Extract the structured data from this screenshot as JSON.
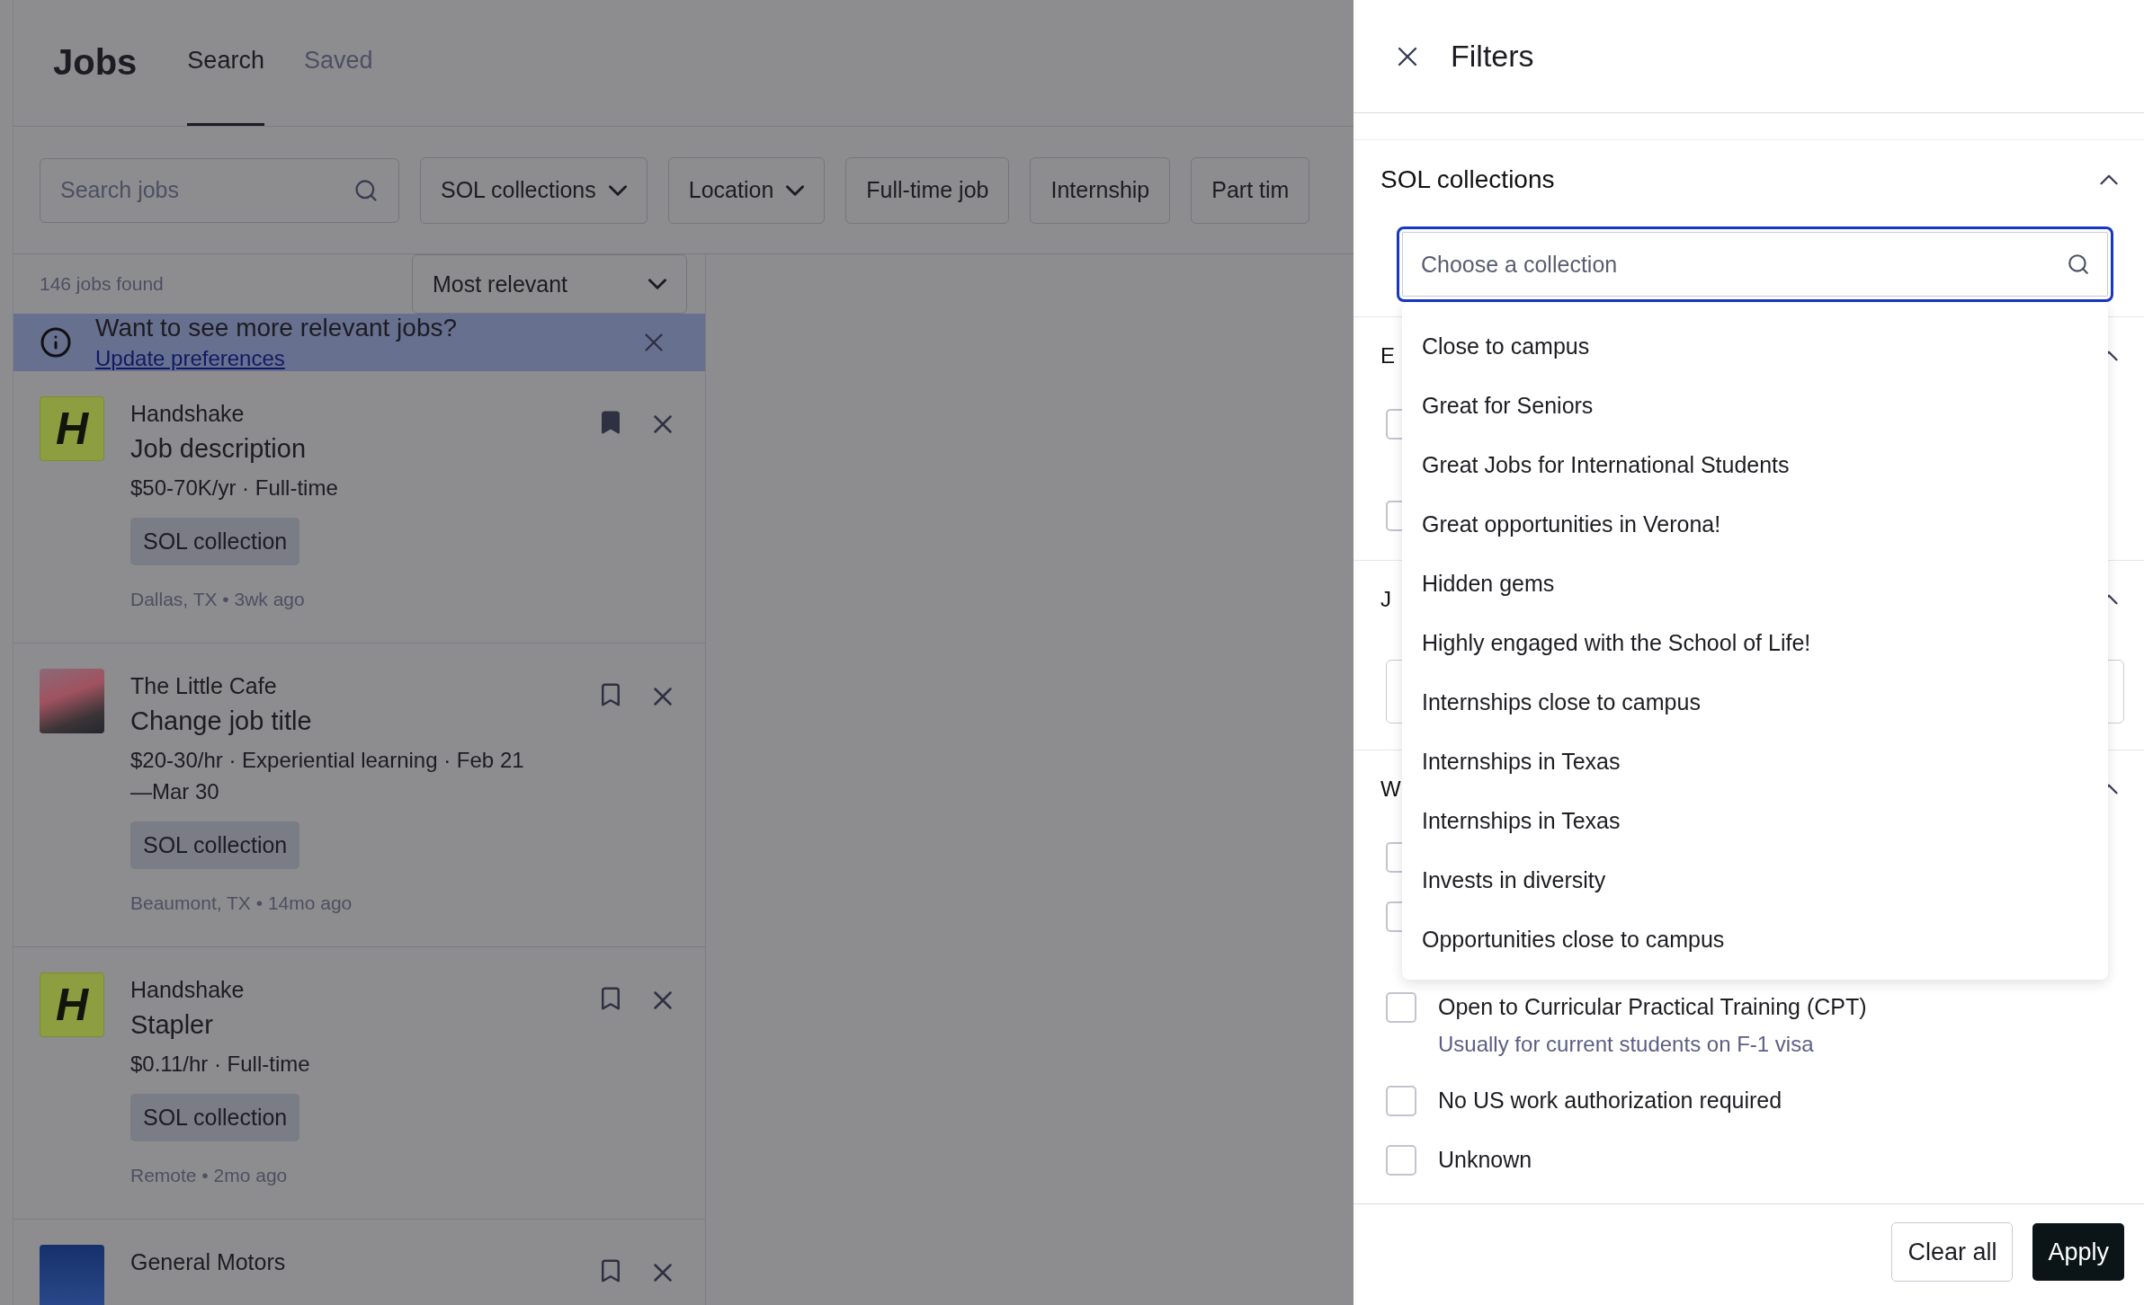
{
  "header": {
    "title": "Jobs",
    "tabs": [
      {
        "label": "Search",
        "selected": true
      },
      {
        "label": "Saved",
        "selected": false
      }
    ]
  },
  "filter_bar": {
    "search": {
      "placeholder": "Search jobs"
    },
    "chips": [
      {
        "label": "SOL collections",
        "kind": "dropdown"
      },
      {
        "label": "Location",
        "kind": "dropdown"
      },
      {
        "label": "Full-time job",
        "kind": "toggle"
      },
      {
        "label": "Internship",
        "kind": "toggle"
      },
      {
        "label": "Part tim",
        "kind": "toggle"
      }
    ]
  },
  "results": {
    "count": "146 jobs found",
    "sort": "Most relevant"
  },
  "banner": {
    "text": "Want to see more relevant jobs?",
    "link": "Update preferences"
  },
  "jobs": [
    {
      "logo": {
        "kind": "letter",
        "text": "H"
      },
      "company": "Handshake",
      "title": "Job description",
      "details": "$50-70K/yr · Full-time",
      "tag": "SOL collection",
      "meta": "Dallas, TX • 3wk ago",
      "saved": true
    },
    {
      "logo": {
        "kind": "photo"
      },
      "company": "The Little Cafe",
      "title": "Change job title",
      "details": "$20-30/hr · Experiential learning · Feb 21—Mar 30",
      "tag": "SOL collection",
      "meta": "Beaumont, TX • 14mo ago",
      "saved": false
    },
    {
      "logo": {
        "kind": "letter",
        "text": "H"
      },
      "company": "Handshake",
      "title": "Stapler",
      "details": "$0.11/hr · Full-time",
      "tag": "SOL collection",
      "meta": "Remote • 2mo ago",
      "saved": false
    },
    {
      "logo": {
        "kind": "block"
      },
      "company": "General Motors",
      "saved": false
    }
  ],
  "filters": {
    "title": "Filters",
    "sections": [
      {
        "kind": "search",
        "title": "SOL collections",
        "expanded": true,
        "placeholder": "Choose a collection",
        "options": [
          "Close to campus",
          "Great for Seniors",
          "Great Jobs for International Students",
          "Great opportunities in Verona!",
          "Hidden gems",
          "Highly engaged with the School of Life!",
          "Internships close to campus",
          "Internships in Texas",
          "Internships in Texas",
          "Invests in diversity",
          "Opportunities close to campus"
        ]
      },
      {
        "kind": "checklist",
        "title": "E",
        "expanded": true,
        "items": [
          {
            "checked": false
          },
          {
            "checked": false
          }
        ]
      },
      {
        "kind": "field",
        "title": "J",
        "expanded": true
      },
      {
        "kind": "checklist",
        "title": "W",
        "expanded": true,
        "items": [
          {
            "checked": false
          },
          {
            "checked": false,
            "spaced": true
          },
          {
            "label": "Open to Curricular Practical Training (CPT)",
            "hint": "Usually for current students on F-1 visa",
            "checked": false
          },
          {
            "label": "No US work authorization required",
            "checked": false
          },
          {
            "label": "Unknown",
            "checked": false
          }
        ]
      }
    ],
    "buttons": [
      {
        "label": "Clear all",
        "kind": "secondary"
      },
      {
        "label": "Apply",
        "kind": "primary"
      }
    ]
  }
}
